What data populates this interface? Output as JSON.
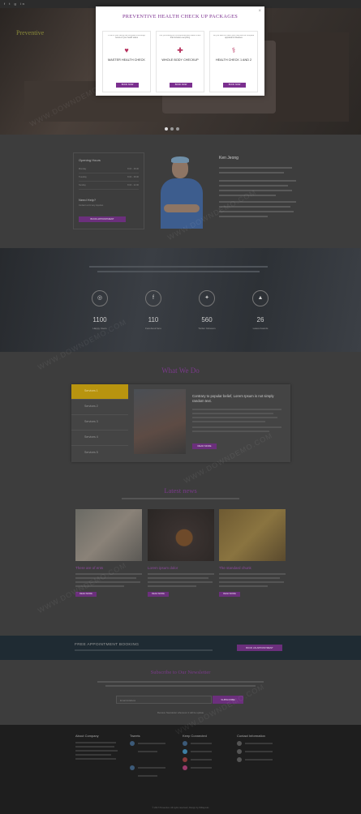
{
  "topbar": {
    "social": "f  t  g  in"
  },
  "hero": {
    "brand": "Preventive"
  },
  "modal": {
    "title": "PREVENTIVE HEALTH CHECK UP PACKAGES",
    "close": "×",
    "cards": [
      {
        "desc": "If one of your family had complete a thorough review of your health status",
        "name": "MASTER HEALTH CHECK",
        "icon": "heart-icon",
        "button": "BOOK NOW"
      },
      {
        "desc": "Are you looking for a comprehensive health check that includes everything",
        "name": "WHOLE BODY CHECKUP",
        "icon": "medkit-icon",
        "button": "BOOK NOW"
      },
      {
        "desc": "Do you want to check your body and fat complete appraisal of diseases",
        "name": "HEALTH CHECK 1 AND 2",
        "icon": "doctor-icon",
        "button": "BOOK NOW"
      }
    ]
  },
  "about": {
    "hours_title": "Opening Hours",
    "hours": [
      {
        "day": "Monday",
        "time": "8.00 - 18.00"
      },
      {
        "day": "Tuesday",
        "time": "8.00 - 18.00"
      },
      {
        "day": "Sunday",
        "time": "8.00 - 12.00"
      }
    ],
    "help_title": "Need Help?",
    "help_text": "Contact us for any inquiries",
    "book_button": "BOOK APPOINTMENT",
    "doctor_name": "Ken Jeong"
  },
  "stats": [
    {
      "icon": "◎",
      "number": "1100",
      "label": "Happy Users"
    },
    {
      "icon": "f",
      "number": "110",
      "label": "Facebook fans"
    },
    {
      "icon": "✦",
      "number": "560",
      "label": "Twitter followers"
    },
    {
      "icon": "▲",
      "number": "26",
      "label": "Latest Awards"
    }
  ],
  "what": {
    "title": "What We Do",
    "services": [
      "Services 1",
      "Services 2",
      "Services 3",
      "Services 4",
      "Services 5"
    ],
    "heading": "Contrary to popular belief, Lorem Ipsum is not simply random text.",
    "button": "READ MORE"
  },
  "news": {
    "title": "Latest news",
    "articles": [
      {
        "title": "There are of ents",
        "button": "READ MORE"
      },
      {
        "title": "Lorem ipsum dolor",
        "button": "READ MORE"
      },
      {
        "title": "The standard chunk",
        "button": "READ MORE"
      }
    ]
  },
  "appointment": {
    "title": "FREE APPOINTMENT BOOKING",
    "button": "BOOK AN APPOINTMENT"
  },
  "newsletter": {
    "title": "Subscribe to Our Newsletter",
    "placeholder": "Email Address",
    "button": "SUBSCRIBE",
    "note": "Receive Newsletter whenever it will be update"
  },
  "footer": {
    "cols": [
      "About Company",
      "Tweets",
      "Keep Connected",
      "Contact Information"
    ],
    "copyright": "© 2017 Preventive. All rights reserved | Design by W3layouts"
  },
  "watermark": "WWW.DOWNDEMO.COM"
}
